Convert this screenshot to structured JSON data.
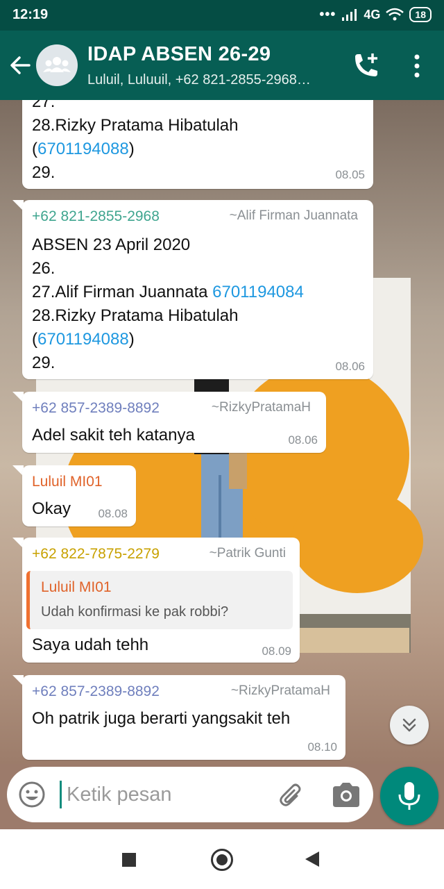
{
  "status_bar": {
    "time": "12:19",
    "dots": "•••",
    "network": "4G",
    "battery": "18"
  },
  "header": {
    "title": "IDAP ABSEN 26-29",
    "subtitle": "Luluil, Luluuil, +62 821-2855-2968…",
    "back_icon": "arrow-left-icon",
    "add_call_icon": "add-call-icon",
    "more_icon": "more-vert-icon"
  },
  "messages": [
    {
      "lines": [
        "27.",
        "28.Rizky Pratama Hibatulah",
        "(",
        "6701194088",
        ")",
        "29."
      ],
      "time": "08.05"
    },
    {
      "sender": "+62 821-2855-2968",
      "sender_color": "#3fa58f",
      "alias": "~Alif Firman Juannata",
      "line1": "ABSEN 23 April 2020",
      "line2": "26.",
      "line3_text": "27.Alif Firman Juannata ",
      "line3_link": "6701194084",
      "line4": "28.Rizky Pratama Hibatulah",
      "line5_open": "(",
      "line5_link": "6701194088",
      "line5_close": ")",
      "line6": "29.",
      "time": "08.06"
    },
    {
      "sender": "+62 857-2389-8892",
      "sender_color": "#6f7fbd",
      "alias": "~RizkyPratamaH",
      "text": "Adel sakit teh katanya",
      "time": "08.06"
    },
    {
      "sender": "Luluil MI01",
      "sender_color": "#e0632a",
      "text": "Okay",
      "time": "08.08"
    },
    {
      "sender": "+62 822-7875-2279",
      "sender_color": "#c8a100",
      "alias": "~Patrik Gunti",
      "quote_sender": "Luluil MI01",
      "quote_text": "Udah konfirmasi ke pak robbi?",
      "text": "Saya udah tehh",
      "time": "08.09"
    },
    {
      "sender": "+62 857-2389-8892",
      "sender_color": "#6f7fbd",
      "alias": "~RizkyPratamaH",
      "text": "Oh patrik juga berarti yangsakit teh",
      "time": "08.10"
    }
  ],
  "scroll_button_icon": "chevron-double-down-icon",
  "composer": {
    "placeholder": "Ketik pesan",
    "emoji_icon": "emoji-icon",
    "attach_icon": "paperclip-icon",
    "camera_icon": "camera-icon",
    "mic_icon": "mic-icon"
  },
  "nav": {
    "recents_icon": "square-icon",
    "home_icon": "home-circle-icon",
    "back_icon": "triangle-back-icon"
  },
  "colors": {
    "header": "#075e54",
    "status_bar": "#054d44",
    "accent": "#00897b",
    "link": "#1e98e0"
  }
}
